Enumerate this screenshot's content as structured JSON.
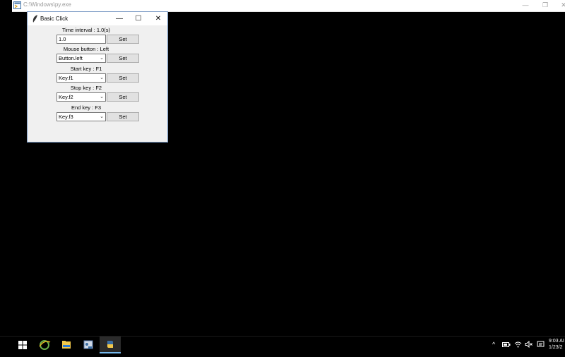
{
  "console": {
    "title": "C:\\Windows\\py.exe",
    "minimize": "—",
    "restore": "❐",
    "close": "✕"
  },
  "dialog": {
    "title": "Basic Click",
    "minimize": "—",
    "maximize": "☐",
    "close": "✕",
    "time_interval_label": "Time interval : 1.0(s)",
    "time_interval_value": "1.0",
    "mouse_button_label": "Mouse button : Left",
    "mouse_button_value": "Button.left",
    "start_key_label": "Start key : F1",
    "start_key_value": "Key.f1",
    "stop_key_label": "Stop key : F2",
    "stop_key_value": "Key.f2",
    "end_key_label": "End key : F3",
    "end_key_value": "Key.f3",
    "set_label": "Set"
  },
  "taskbar": {
    "icons": [
      "windows-start-icon",
      "ie-icon",
      "file-explorer-icon",
      "control-panel-icon",
      "python-icon"
    ],
    "clock_time": "9:03 AI",
    "clock_date": "1/23/2"
  }
}
